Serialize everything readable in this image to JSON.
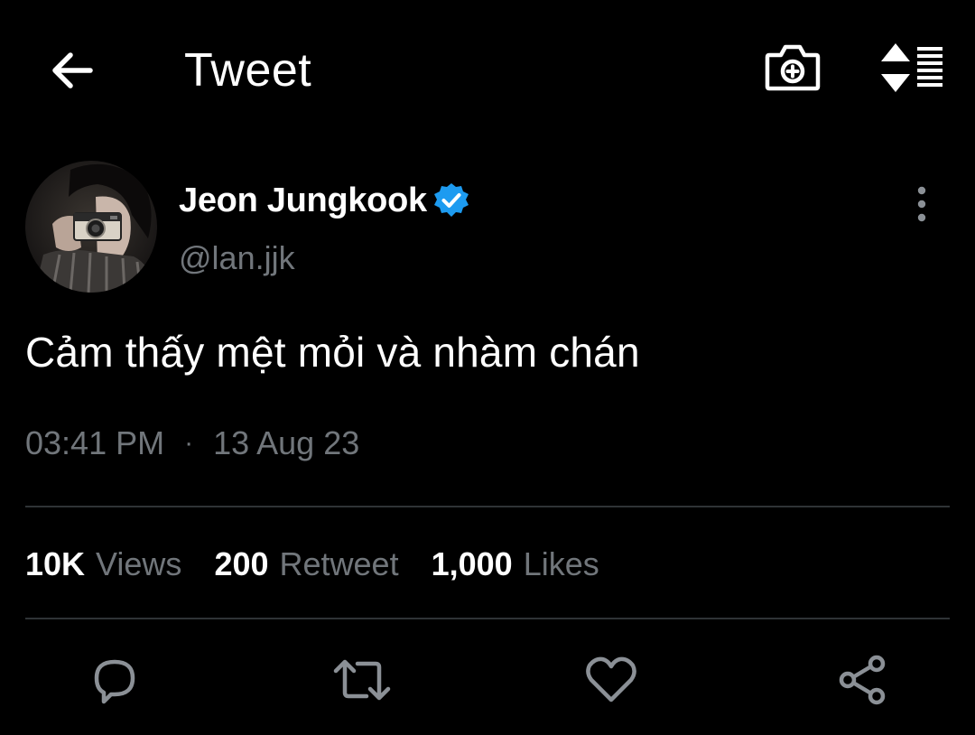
{
  "header": {
    "title": "Tweet",
    "back_icon": "arrow-left-icon",
    "camera_icon": "camera-plus-icon",
    "sort_icon": "sort-list-icon"
  },
  "author": {
    "name": "Jeon Jungkook",
    "handle": "@lan.jjk",
    "verified": true,
    "verified_color": "#1d9bf0"
  },
  "tweet": {
    "text": "Cảm thấy mệt mỏi và nhàm chán",
    "time": "03:41 PM",
    "separator": "·",
    "date": "13 Aug 23"
  },
  "stats": {
    "views_count": "10K",
    "views_label": "Views",
    "retweets_count": "200",
    "retweets_label": "Retweet",
    "likes_count": "1,000",
    "likes_label": "Likes"
  },
  "actions": {
    "reply_icon": "reply-icon",
    "retweet_icon": "retweet-icon",
    "like_icon": "heart-icon",
    "share_icon": "share-icon"
  },
  "colors": {
    "background": "#000000",
    "text_primary": "#ffffff",
    "text_secondary": "#71767b",
    "divider": "#2f3336",
    "accent": "#1d9bf0"
  }
}
